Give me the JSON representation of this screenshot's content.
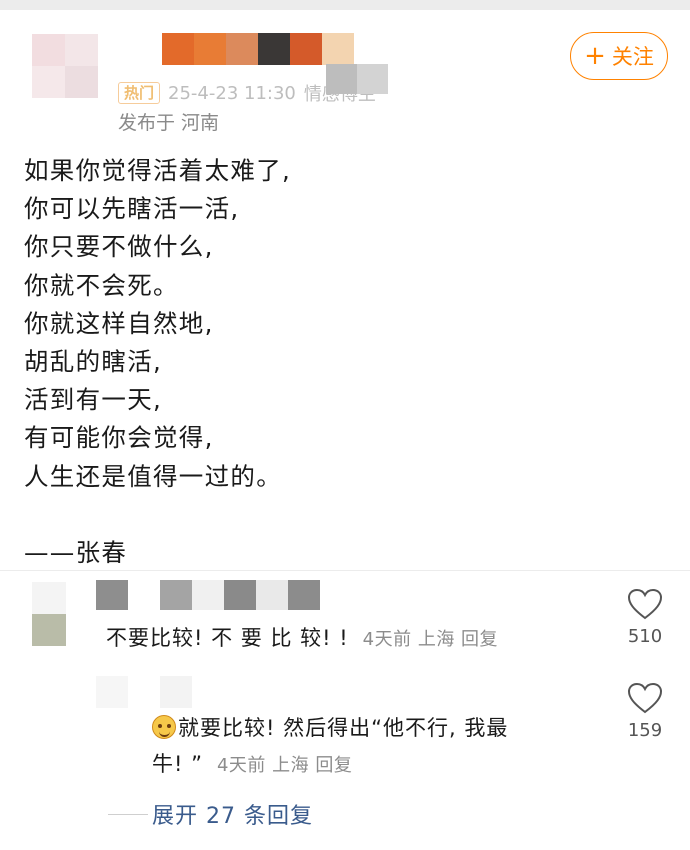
{
  "post": {
    "badge": "热门",
    "timestamp": "25-4-23 11:30",
    "role": "情感博主",
    "location": "发布于 河南",
    "follow_label": "关注",
    "lines": [
      "如果你觉得活着太难了,",
      "你可以先瞎活一活,",
      "你只要不做什么,",
      "你就不会死。",
      "你就这样自然地,",
      "胡乱的瞎活,",
      "活到有一天,",
      "有可能你会觉得,",
      "人生还是值得一过的。",
      "",
      "——张春"
    ]
  },
  "comments": [
    {
      "text": "不要比较! 不 要 比 较! !",
      "meta": "4天前 上海  回复",
      "likes": "510"
    },
    {
      "text_line1": "就要比较! 然后得出“他不行, 我最",
      "text_line2": "牛! ”",
      "meta": "4天前 上海  回复",
      "likes": "159",
      "emoji": "laughing-face-icon"
    }
  ],
  "expand_label": "展开 27 条回复",
  "colors": {
    "accent": "#ff8200",
    "link": "#3a5b8c",
    "meta": "#8c8c8c"
  }
}
